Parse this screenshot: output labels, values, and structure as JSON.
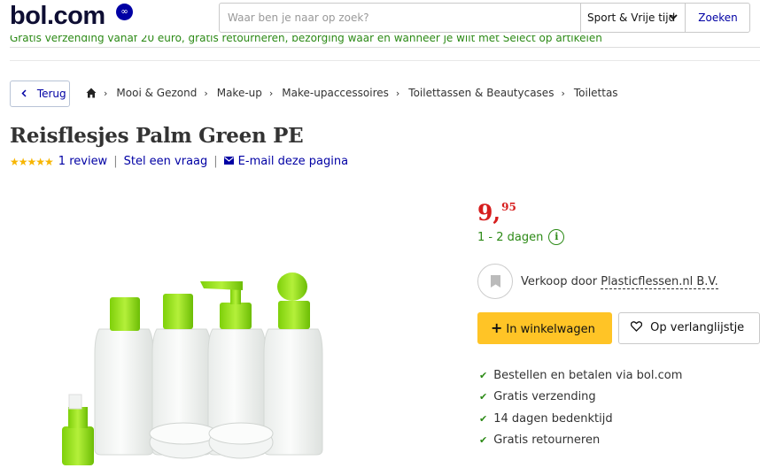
{
  "header": {
    "logo_text": "bol.com",
    "logo_badge": "∞",
    "search_placeholder": "Waar ben je naar op zoek?",
    "category": "Sport & Vrije tijd",
    "search_button": "Zoeken",
    "promo_text": "Gratis verzending vanaf 20 euro, gratis retourneren, bezorging waar en wanneer je wilt met Select op artikelen"
  },
  "breadcrumb": {
    "back_label": "Terug",
    "items": [
      "Mooi & Gezond",
      "Make-up",
      "Make-upaccessoires",
      "Toilettassen & Beautycases",
      "Toilettas"
    ]
  },
  "product": {
    "title": "Reisflesjes Palm Green PE",
    "stars": "★★★★★",
    "rating_value": 5,
    "review_link": "1 review",
    "ask_link": "Stel een vraag",
    "email_link": "E-mail deze pagina"
  },
  "offer": {
    "price_int": "9,",
    "price_frac": "95",
    "delivery": "1 - 2 dagen",
    "seller_prefix": "Verkoop door",
    "seller_name": "Plasticflessen.nl B.V.",
    "cart_button": "In winkelwagen",
    "wishlist_button": "Op verlanglijstje",
    "usps": [
      "Bestellen en betalen via bol.com",
      "Gratis verzending",
      "14 dagen bedenktijd",
      "Gratis retourneren"
    ]
  },
  "colors": {
    "brand_blue": "#0000a4",
    "price_red": "#d61d1d",
    "delivery_green": "#2c8a16",
    "cart_yellow": "#ffc426",
    "star_yellow": "#f7b500"
  }
}
